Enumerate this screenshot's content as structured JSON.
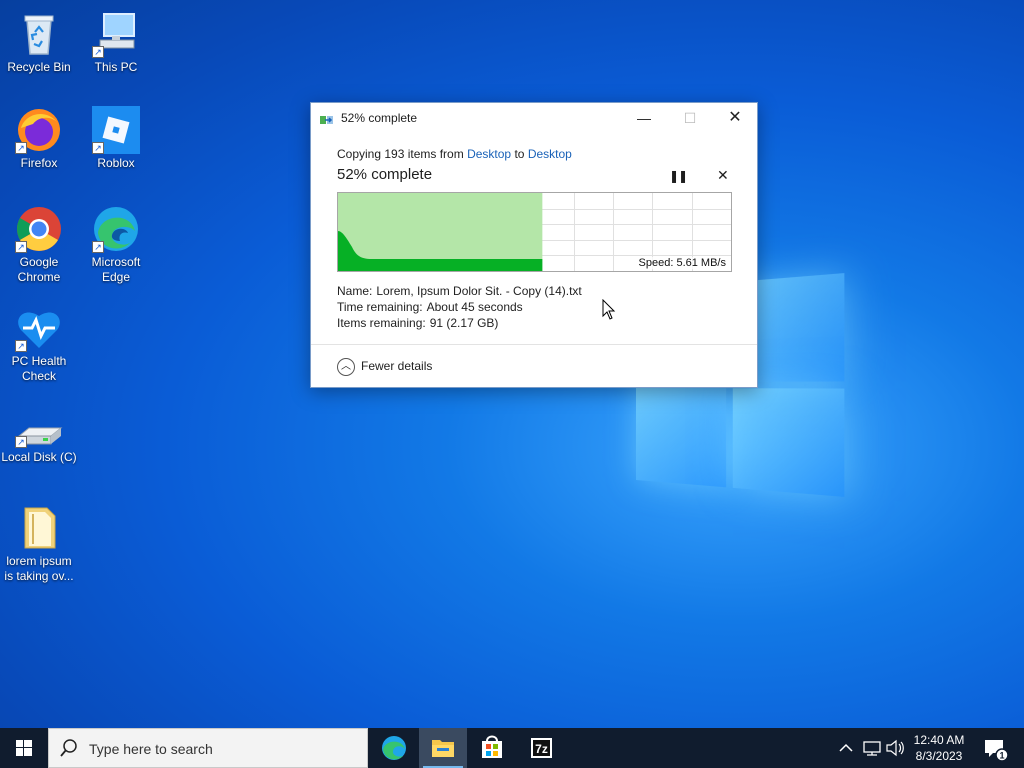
{
  "desktop": {
    "icons": [
      {
        "label": "Recycle Bin"
      },
      {
        "label": "This PC"
      },
      {
        "label": "Firefox"
      },
      {
        "label": "Roblox"
      },
      {
        "label": "Google Chrome"
      },
      {
        "label": "Microsoft Edge"
      },
      {
        "label": "PC Health Check"
      },
      {
        "label": "Local Disk (C)"
      },
      {
        "label": "lorem ipsum is taking ov..."
      }
    ]
  },
  "dialog": {
    "title": "52% complete",
    "copying_prefix": "Copying 193 items from",
    "source": "Desktop",
    "to_word": "to",
    "destination": "Desktop",
    "percent_text": "52% complete",
    "progress_fraction": 0.52,
    "speed_text": "Speed: 5.61 MB/s",
    "name_label": "Name:",
    "name_value": "Lorem, Ipsum Dolor Sit. - Copy (14).txt",
    "time_label": "Time remaining:",
    "time_value": "About 45 seconds",
    "items_label": "Items remaining:",
    "items_value": "91 (2.17 GB)",
    "fewer_details": "Fewer details",
    "pause_glyph": "❚❚",
    "cancel_glyph": "✕"
  },
  "taskbar": {
    "search_placeholder": "Type here to search",
    "apps": [
      "edge-icon",
      "file-explorer-icon",
      "store-icon",
      "7zip-icon"
    ],
    "sevenzip_label": "7z",
    "clock_time": "12:40 AM",
    "clock_date": "8/3/2023",
    "notification_count": "1"
  },
  "colors": {
    "accent": "#1a62b8",
    "progress_green": "#06b025",
    "progress_fill": "#b4e6a8",
    "taskbar": "#101c2e"
  }
}
